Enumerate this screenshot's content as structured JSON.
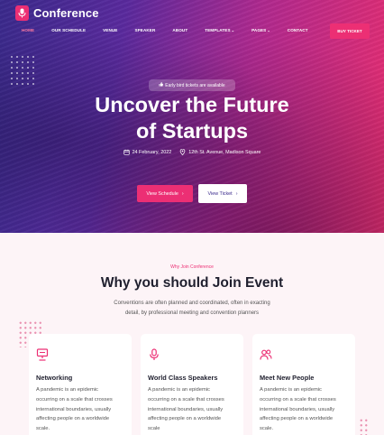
{
  "brand": {
    "name": "Conference"
  },
  "nav": {
    "items": [
      {
        "label": "HOME",
        "active": true,
        "dropdown": false
      },
      {
        "label": "OUR SCHEDULE",
        "active": false,
        "dropdown": false
      },
      {
        "label": "VENUE",
        "active": false,
        "dropdown": false
      },
      {
        "label": "SPEAKER",
        "active": false,
        "dropdown": false
      },
      {
        "label": "ABOUT",
        "active": false,
        "dropdown": false
      },
      {
        "label": "TEMPLATES",
        "active": false,
        "dropdown": true
      },
      {
        "label": "PAGES",
        "active": false,
        "dropdown": true
      },
      {
        "label": "CONTACT",
        "active": false,
        "dropdown": false
      }
    ],
    "cta": "BUY TICKET"
  },
  "hero": {
    "badge": "Early bird tickets are available",
    "title_line1": "Uncover the Future",
    "title_line2": "of Startups",
    "date": "24 February, 2022",
    "location": "12th St. Avenue, Madison Square",
    "primary_btn": "View Schedule",
    "secondary_btn": "View Ticket"
  },
  "why": {
    "eyebrow": "Why Join Conference",
    "title": "Why you should Join Event",
    "desc_line1": "Conventions are often planned and coordinated, often in exacting",
    "desc_line2": "detail, by professional meeting and convention planners"
  },
  "cards": [
    {
      "icon": "presentation-board-icon",
      "title": "Networking",
      "lines": [
        "A pandemic is an epidemic",
        "occurring on a scale that crosses",
        "international boundaries, usually",
        "affecting people on a worldwide",
        "scale."
      ]
    },
    {
      "icon": "microphone-icon",
      "title": "World Class Speakers",
      "lines": [
        "A pandemic is an epidemic",
        "occurring on a scale that crosses",
        "international boundaries, usually",
        "affecting people on a worldwide",
        "scale"
      ]
    },
    {
      "icon": "people-icon",
      "title": "Meet New People",
      "lines": [
        "A pandemic is an epidemic",
        "occurring on a scale that crosses",
        "international boundaries, usually",
        "affecting people on a worldwide",
        "scale."
      ]
    }
  ],
  "colors": {
    "accent": "#ec2f74",
    "hero_start": "#3a2a8c",
    "hero_end": "#ea2e70",
    "section_bg": "#fdf4f7"
  }
}
